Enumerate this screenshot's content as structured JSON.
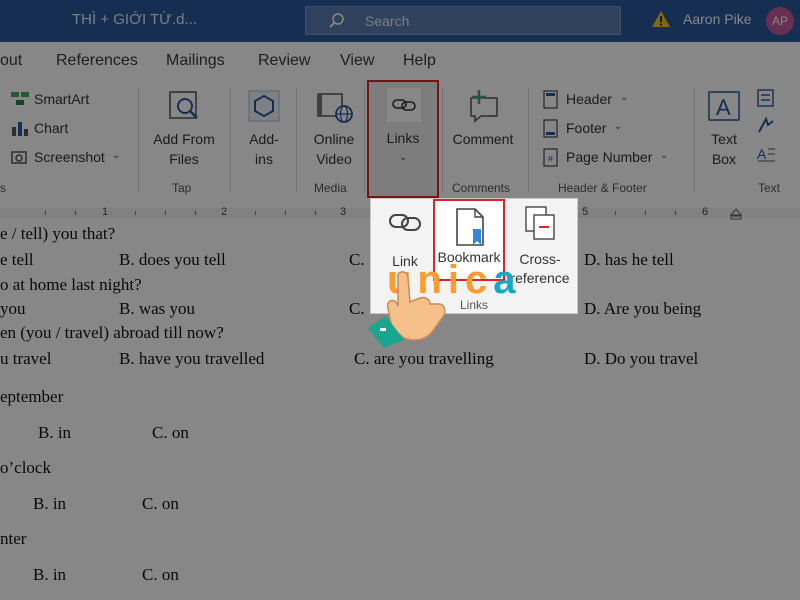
{
  "window": {
    "title": "THÌ + GIỚI TỪ.d...",
    "search_placeholder": "Search",
    "user_name": "Aaron Pike",
    "user_initials": "AP"
  },
  "tabs": [
    "out",
    "References",
    "Mailings",
    "Review",
    "View",
    "Help"
  ],
  "ribbon": {
    "illustrations": {
      "smartart": "SmartArt",
      "chart": "Chart",
      "screenshot": "Screenshot",
      "group_label": "s"
    },
    "tap": {
      "add_from_files_1": "Add From",
      "add_from_files_2": "Files",
      "group_label": "Tap"
    },
    "addins": {
      "label_1": "Add-",
      "label_2": "ins"
    },
    "media": {
      "online_video_1": "Online",
      "online_video_2": "Video",
      "group_label": "Media"
    },
    "links": {
      "label": "Links"
    },
    "comments": {
      "comment": "Comment",
      "group_label": "Comments"
    },
    "header_footer": {
      "header": "Header",
      "footer": "Footer",
      "page_number": "Page Number",
      "group_label": "Header & Footer"
    },
    "text": {
      "text_box_1": "Text",
      "text_box_2": "Box",
      "group_label": "Text"
    }
  },
  "ruler": {
    "numbers": [
      "1",
      "2",
      "3",
      "5",
      "6"
    ]
  },
  "links_dropdown": {
    "link": "Link",
    "bookmark": "Bookmark",
    "cross_reference_1": "Cross-",
    "cross_reference_2": "reference",
    "group_label": "Links"
  },
  "document": {
    "lines": [
      {
        "text": "e / tell) you that?"
      },
      {
        "text": "e tell"
      },
      {
        "text": "B. does you tell"
      },
      {
        "text": "C."
      },
      {
        "text": "D. has he tell"
      },
      {
        "text": "o at home last night?"
      },
      {
        "text": "you"
      },
      {
        "text": "B. was you"
      },
      {
        "text": "C."
      },
      {
        "text": "D. Are you being"
      },
      {
        "text": "en (you / travel) abroad till now?"
      },
      {
        "text": "u travel"
      },
      {
        "text": "B. have you travelled"
      },
      {
        "text": "C. are you travelling"
      },
      {
        "text": "D. Do you travel"
      },
      {
        "text": "eptember"
      },
      {
        "text": "B. in"
      },
      {
        "text": "C. on"
      },
      {
        "text": "o’clock"
      },
      {
        "text": "B. in"
      },
      {
        "text": "C. on"
      },
      {
        "text": "nter"
      },
      {
        "text": "B. in"
      },
      {
        "text": "C. on"
      }
    ]
  },
  "watermark": {
    "logo_text_1": "un",
    "logo_text_2": "ic",
    "logo_text_3": "a"
  },
  "colors": {
    "titlebar": "#2b579a",
    "highlight": "#d9262c",
    "logo_orange": "#ff9b2f",
    "logo_teal": "#19a7c4"
  }
}
